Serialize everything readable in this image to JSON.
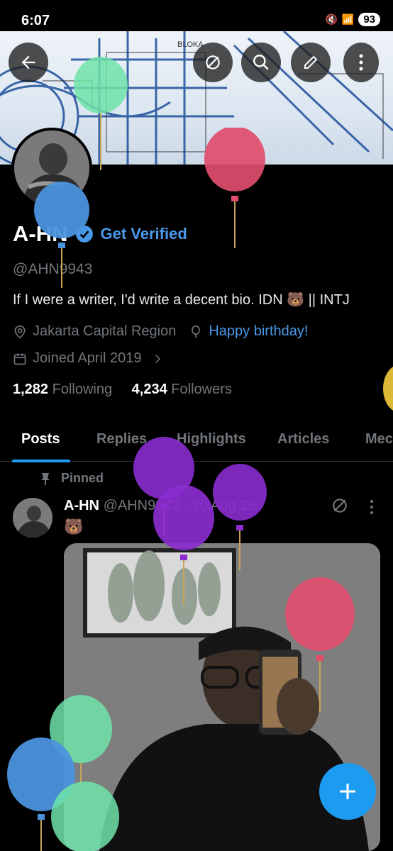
{
  "status_bar": {
    "time": "6:07",
    "battery": "93"
  },
  "profile": {
    "name": "A-HN",
    "get_verified": "Get Verified",
    "handle": "@AHN9943",
    "bio": "If I were a writer, I'd write a decent bio.  IDN 🐻 || INTJ",
    "location": "Jakarta Capital Region",
    "birthday": "Happy birthday!",
    "joined": "Joined April 2019",
    "following_count": "1,282",
    "following_label": "Following",
    "followers_count": "4,234",
    "followers_label": "Followers"
  },
  "tabs": [
    "Posts",
    "Replies",
    "Highlights",
    "Articles",
    "Mec"
  ],
  "post": {
    "pinned_label": "Pinned",
    "name": "A-HN",
    "meta": "@AHN9943 · 30 Aug 25",
    "emoji": "🐻"
  },
  "fab": {
    "label": "+"
  },
  "colors": {
    "accent": "#1d9bf0",
    "verified_text": "#4a99e9",
    "background": "#000000"
  },
  "icons": [
    "back-arrow-icon",
    "grok-icon",
    "search-icon",
    "edit-icon",
    "more-vertical-icon",
    "verified-badge-icon",
    "location-icon",
    "balloon-icon",
    "calendar-icon",
    "chevron-right-icon",
    "pin-icon",
    "plus-icon"
  ]
}
